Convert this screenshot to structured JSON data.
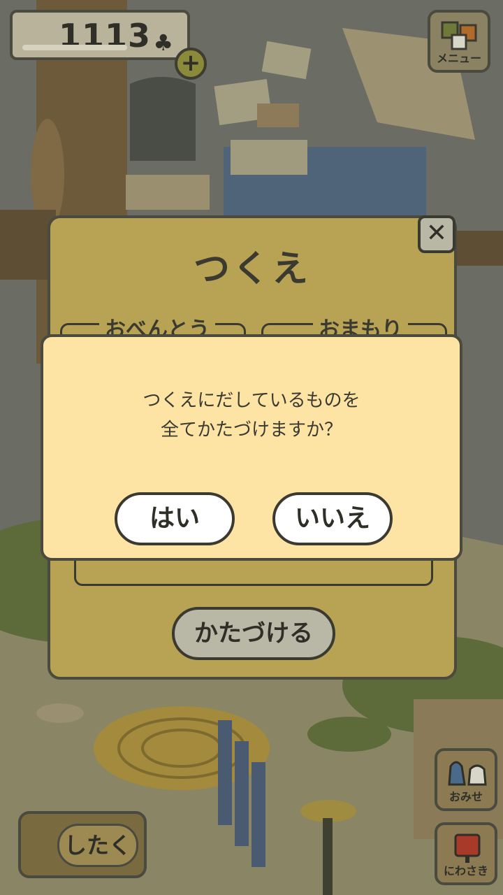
{
  "hud": {
    "clover_count": "1113",
    "clover_symbol": "♣",
    "plus_label": "+"
  },
  "menu": {
    "label": "メニュー",
    "icon": "menu-icon"
  },
  "side_buttons": {
    "shop_label": "おみせ",
    "garden_label": "にわさき"
  },
  "prepare_button": "したく",
  "desk_dialog": {
    "title": "つくえ",
    "sections": [
      "おべんとう",
      "おまもり"
    ],
    "clear_button": "かたづける",
    "close_symbol": "✕"
  },
  "confirm_dialog": {
    "message": "つくえにだしているものを\n全てかたづけますか？",
    "yes_label": "はい",
    "no_label": "いいえ"
  },
  "colors": {
    "confirm_bg": "#fde3a4",
    "panel_bg": "#b8a254",
    "outline": "#4b4a3e"
  }
}
